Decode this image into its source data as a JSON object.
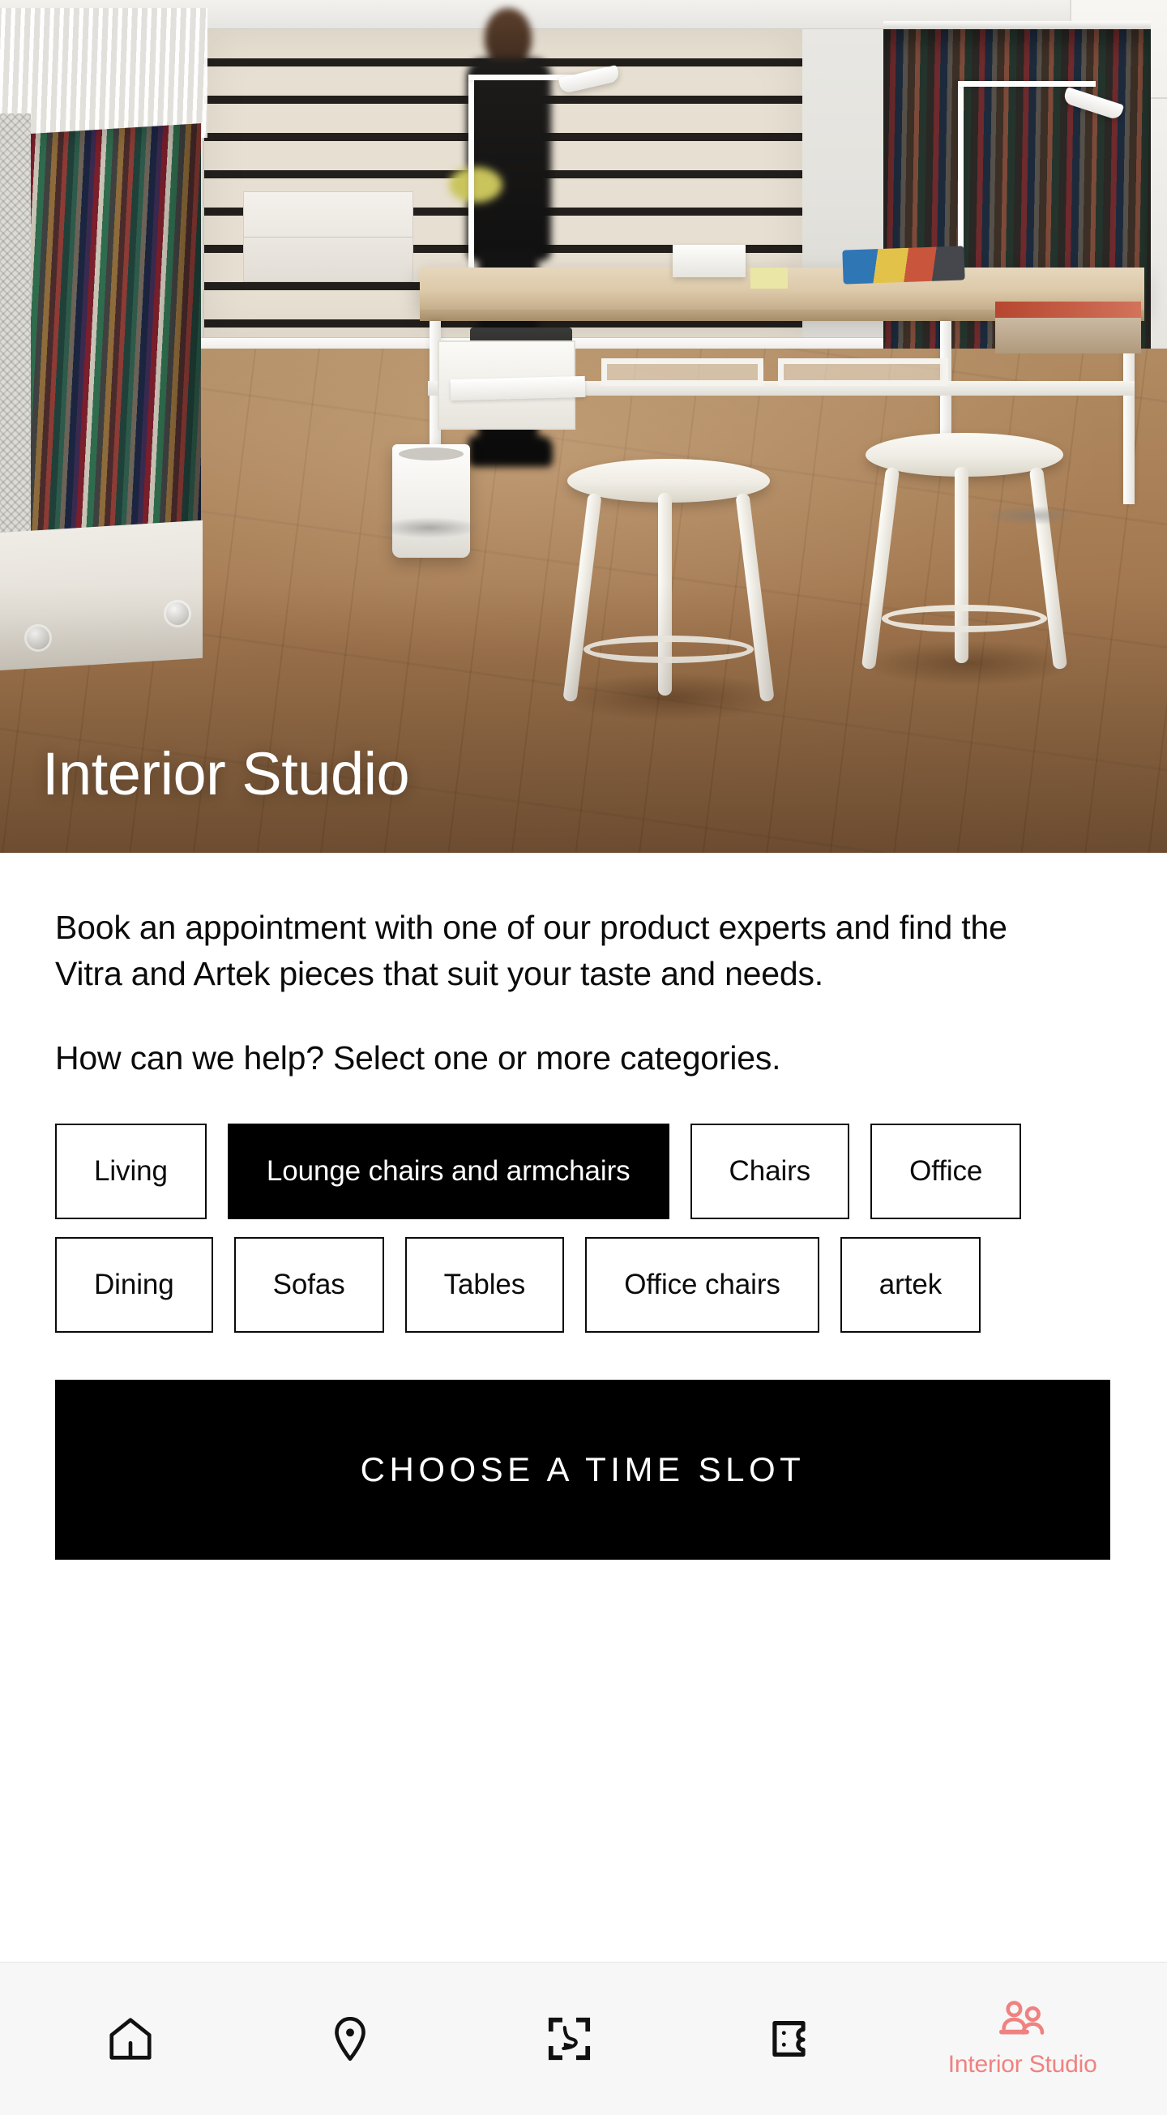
{
  "hero": {
    "title": "Interior Studio",
    "image_alt": "Interior design studio showroom with fabric sample racks, slatted shelving wall, a light wood work table, two white stools and a person walking"
  },
  "content": {
    "intro": "Book an appointment with one of our product experts and find the Vitra and Artek pieces that suit your taste and needs.",
    "question": "How can we help? Select one or more categories.",
    "categories": [
      {
        "label": "Living",
        "selected": false
      },
      {
        "label": "Lounge chairs and armchairs",
        "selected": true
      },
      {
        "label": "Chairs",
        "selected": false
      },
      {
        "label": "Office",
        "selected": false
      },
      {
        "label": "Dining",
        "selected": false
      },
      {
        "label": "Sofas",
        "selected": false
      },
      {
        "label": "Tables",
        "selected": false
      },
      {
        "label": "Office chairs",
        "selected": false
      },
      {
        "label": "artek",
        "selected": false
      }
    ],
    "cta_label": "CHOOSE A TIME SLOT"
  },
  "bottom_nav": {
    "items": [
      {
        "icon": "home-icon",
        "label": "",
        "active": false
      },
      {
        "icon": "location-pin-icon",
        "label": "",
        "active": false
      },
      {
        "icon": "scan-chair-icon",
        "label": "",
        "active": false
      },
      {
        "icon": "ticket-icon",
        "label": "",
        "active": false
      },
      {
        "icon": "two-people-icon",
        "label": "Interior Studio",
        "active": true
      }
    ]
  },
  "colors": {
    "accent": "#ef8280",
    "selected_chip_bg": "#000000",
    "cta_bg": "#000000",
    "text": "#0b0b0b",
    "nav_bg": "#f7f7f7"
  }
}
